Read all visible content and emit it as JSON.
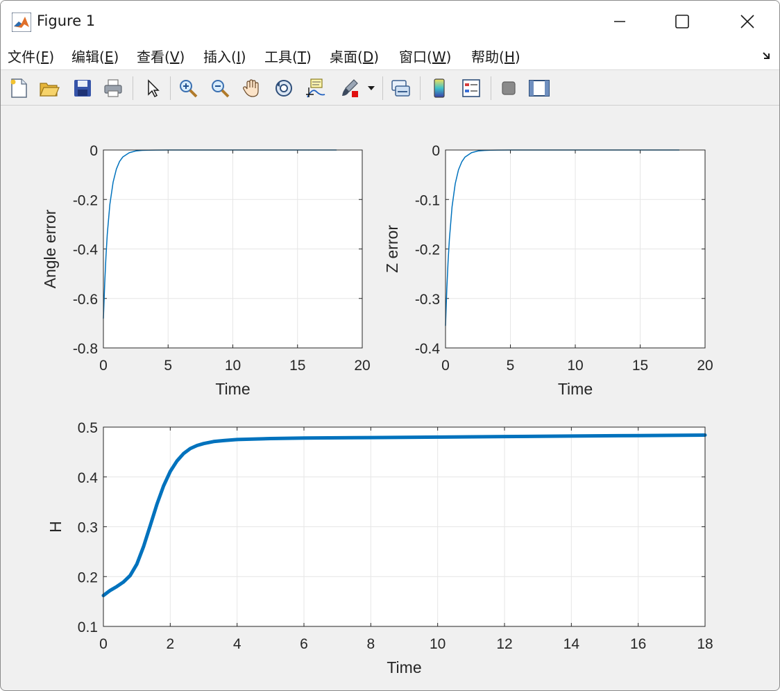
{
  "window": {
    "title": "Figure 1",
    "icons": {
      "app": "matlab-logo-icon",
      "minimize": "minimize-icon",
      "maximize": "maximize-icon",
      "close": "close-icon"
    }
  },
  "menu": [
    {
      "label": "文件",
      "key": "F"
    },
    {
      "label": "编辑",
      "key": "E"
    },
    {
      "label": "查看",
      "key": "V"
    },
    {
      "label": "插入",
      "key": "I"
    },
    {
      "label": "工具",
      "key": "T"
    },
    {
      "label": "桌面",
      "key": "D"
    },
    {
      "label": "窗口",
      "key": "W"
    },
    {
      "label": "帮助",
      "key": "H"
    }
  ],
  "toolbar": [
    "new-figure-icon",
    "open-file-icon",
    "save-icon",
    "print-icon",
    "edit-plot-arrow-icon",
    "zoom-in-icon",
    "zoom-out-icon",
    "pan-hand-icon",
    "rotate-3d-icon",
    "data-cursor-icon",
    "brush-icon",
    "link-plot-icon",
    "colorbar-icon",
    "legend-icon",
    "hide-plot-tools-icon",
    "show-plot-tools-icon"
  ],
  "colors": {
    "line": "#0072bd",
    "grid": "#e6e6e6",
    "axis": "#262626",
    "figure_bg": "#f0f0f0"
  },
  "chart_data": [
    {
      "type": "line",
      "xlabel": "Time",
      "ylabel": "Angle error",
      "xlim": [
        0,
        20
      ],
      "ylim": [
        -0.8,
        0
      ],
      "xticks": [
        "0",
        "5",
        "10",
        "15",
        "20"
      ],
      "yticks": [
        "-0.8",
        "-0.6",
        "-0.4",
        "-0.2",
        "0"
      ],
      "grid": true,
      "series": [
        {
          "x": [
            0,
            0.1,
            0.2,
            0.3,
            0.5,
            0.75,
            1.0,
            1.25,
            1.5,
            2.0,
            2.5,
            3.0,
            3.5,
            4.0,
            5.0,
            18.0
          ],
          "y": [
            -0.68,
            -0.54,
            -0.43,
            -0.34,
            -0.22,
            -0.13,
            -0.077,
            -0.046,
            -0.028,
            -0.011,
            -0.004,
            -0.0015,
            -0.0006,
            -0.0002,
            0,
            0
          ]
        }
      ]
    },
    {
      "type": "line",
      "xlabel": "Time",
      "ylabel": "Z error",
      "xlim": [
        0,
        20
      ],
      "ylim": [
        -0.4,
        0
      ],
      "xticks": [
        "0",
        "5",
        "10",
        "15",
        "20"
      ],
      "yticks": [
        "-0.4",
        "-0.3",
        "-0.2",
        "-0.1",
        "0"
      ],
      "grid": true,
      "series": [
        {
          "x": [
            0,
            0.1,
            0.2,
            0.3,
            0.5,
            0.75,
            1.0,
            1.25,
            1.5,
            2.0,
            2.5,
            3.0,
            3.5,
            4.0,
            5.0,
            18.0
          ],
          "y": [
            -0.355,
            -0.28,
            -0.225,
            -0.18,
            -0.115,
            -0.068,
            -0.04,
            -0.024,
            -0.0145,
            -0.0055,
            -0.002,
            -0.0008,
            -0.0003,
            -0.0001,
            0,
            0
          ]
        }
      ]
    },
    {
      "type": "line",
      "xlabel": "Time",
      "ylabel": "H",
      "xlim": [
        0,
        18
      ],
      "ylim": [
        0.1,
        0.5
      ],
      "xticks": [
        "0",
        "2",
        "4",
        "6",
        "8",
        "10",
        "12",
        "14",
        "16",
        "18"
      ],
      "yticks": [
        "0.1",
        "0.2",
        "0.3",
        "0.4",
        "0.5"
      ],
      "grid": true,
      "series": [
        {
          "x": [
            0,
            0.2,
            0.4,
            0.6,
            0.8,
            1.0,
            1.2,
            1.4,
            1.6,
            1.8,
            2.0,
            2.2,
            2.4,
            2.6,
            2.8,
            3.0,
            3.3,
            3.6,
            4.0,
            5.0,
            6.0,
            8.0,
            10.0,
            12.0,
            14.0,
            16.0,
            18.0
          ],
          "y": [
            0.162,
            0.172,
            0.18,
            0.189,
            0.202,
            0.225,
            0.26,
            0.302,
            0.345,
            0.382,
            0.411,
            0.432,
            0.447,
            0.457,
            0.463,
            0.467,
            0.471,
            0.473,
            0.475,
            0.477,
            0.478,
            0.479,
            0.48,
            0.481,
            0.482,
            0.483,
            0.484
          ]
        }
      ]
    }
  ]
}
